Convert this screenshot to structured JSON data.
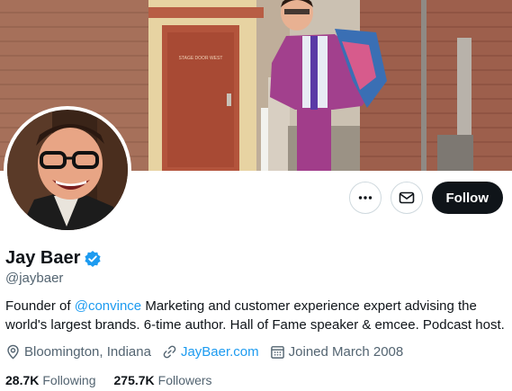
{
  "profile": {
    "display_name": "Jay Baer",
    "handle": "@jaybaer",
    "bio_prefix": "Founder of ",
    "bio_mention": "@convince",
    "bio_rest": " Marketing and customer experience expert advising the world's largest brands. 6-time author. Hall of Fame speaker & emcee. Podcast host.",
    "location": "Bloomington, Indiana",
    "website": "JayBaer.com",
    "joined": "Joined March 2008",
    "following_count": "28.7K",
    "following_label": "Following",
    "followers_count": "275.7K",
    "followers_label": "Followers"
  },
  "banner": {
    "door_sign": "STAGE DOOR WEST"
  },
  "actions": {
    "follow_label": "Follow"
  },
  "icons": {
    "more": "more-icon",
    "message": "envelope-icon",
    "verified": "verified-badge-icon",
    "location": "location-pin-icon",
    "link": "link-icon",
    "calendar": "calendar-icon"
  },
  "colors": {
    "accent": "#1d9bf0",
    "text_primary": "#0f1419",
    "text_secondary": "#536471",
    "follow_button": "#0f1419"
  }
}
